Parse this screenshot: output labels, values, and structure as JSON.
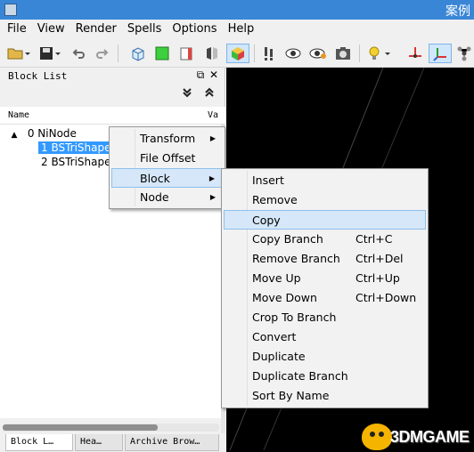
{
  "window": {
    "title": "案例"
  },
  "menubar": [
    "File",
    "View",
    "Render",
    "Spells",
    "Options",
    "Help"
  ],
  "toolbar": {
    "icons": [
      "open-icon",
      "save-icon",
      "undo-icon",
      "redo-icon",
      "box-wire-icon",
      "box-green-icon",
      "box-red-icon",
      "mirror-icon",
      "box-color-icon",
      "exclamation-icon",
      "eye-icon",
      "eye-settings-icon",
      "screenshot-icon",
      "lightbulb-icon",
      "axis-icon",
      "axes-icon",
      "molecule-icon"
    ]
  },
  "block_list": {
    "title": "Block List",
    "columns": {
      "name": "Name",
      "value": "Va"
    },
    "rows": [
      {
        "toggle": "▲",
        "label": "0 NiNode",
        "selected": false
      },
      {
        "label": "1 BSTriShape",
        "selected": true
      },
      {
        "label": "2 BSTriShape",
        "selected": false
      }
    ],
    "tabs": [
      "Block L…",
      "Hea…",
      "Archive Brow…"
    ]
  },
  "context_menu": {
    "items": [
      {
        "label": "Transform",
        "has_submenu": true
      },
      {
        "label": "File Offset",
        "has_submenu": false
      },
      {
        "label": "Block",
        "has_submenu": true,
        "highlighted": true
      },
      {
        "label": "Node",
        "has_submenu": true
      }
    ]
  },
  "block_submenu": {
    "items": [
      {
        "label": "Insert",
        "shortcut": ""
      },
      {
        "label": "Remove",
        "shortcut": ""
      },
      {
        "label": "Copy",
        "shortcut": "",
        "highlighted": true
      },
      {
        "label": "Copy Branch",
        "shortcut": "Ctrl+C"
      },
      {
        "label": "Remove Branch",
        "shortcut": "Ctrl+Del"
      },
      {
        "label": "Move Up",
        "shortcut": "Ctrl+Up"
      },
      {
        "label": "Move Down",
        "shortcut": "Ctrl+Down"
      },
      {
        "label": "Crop To Branch",
        "shortcut": ""
      },
      {
        "label": "Convert",
        "shortcut": ""
      },
      {
        "label": "Duplicate",
        "shortcut": ""
      },
      {
        "label": "Duplicate Branch",
        "shortcut": ""
      },
      {
        "label": "Sort By Name",
        "shortcut": ""
      }
    ]
  },
  "watermark": {
    "text": "3DMGAME"
  }
}
